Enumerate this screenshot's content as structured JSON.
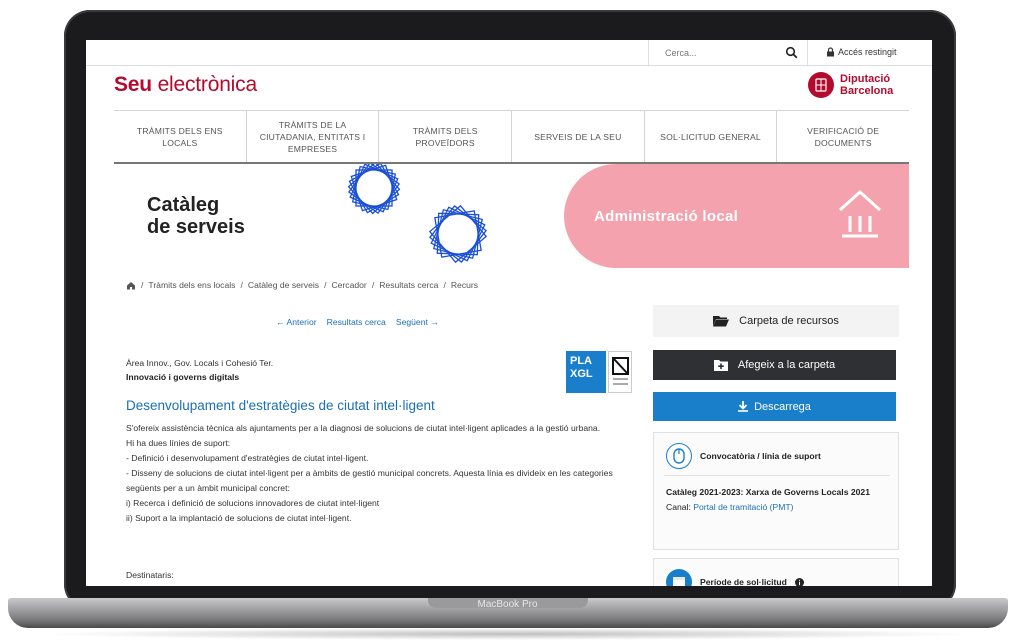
{
  "topbar": {
    "search_placeholder": "Cerca...",
    "restricted_access": "Accés restingit"
  },
  "header": {
    "brand_bold": "Seu",
    "brand_rest": "electrònica",
    "org_line1": "Diputació",
    "org_line2": "Barcelona"
  },
  "nav": {
    "items": [
      "TRÀMITS DELS ENS LOCALS",
      "TRÀMITS DE LA CIUTADANIA, ENTITATS I EMPRESES",
      "TRÀMITS DELS PROVEÏDORS",
      "SERVEIS DE LA SEU",
      "SOL·LICITUD GENERAL",
      "VERIFICACIÓ DE DOCUMENTS"
    ]
  },
  "banner": {
    "title_line1": "Catàleg",
    "title_line2": "de serveis",
    "section": "Administració local"
  },
  "breadcrumb": {
    "items": [
      "Tràmits dels ens locals",
      "Catàleg de serveis",
      "Cercador",
      "Resultats cerca",
      "Recurs"
    ]
  },
  "pager": {
    "prev": "← Anterior",
    "results": "Resultats cerca",
    "next": "Següent →"
  },
  "content": {
    "area": "Àrea Innov., Gov. Locals i Cohesió Ter.",
    "subarea": "Innovació i governs digitals",
    "badge_line1": "PLA",
    "badge_line2": "XGL",
    "title": "Desenvolupament d'estratègies de ciutat intel·ligent",
    "description": [
      "S'ofereix assistència tècnica als ajuntaments per a la diagnosi de solucions de ciutat intel·ligent aplicades a la gestió urbana.",
      "Hi ha dues línies de suport:",
      "- Definició i desenvolupament d'estratègies de ciutat intel·ligent.",
      "- Disseny de solucions de ciutat intel·ligent per a àmbits de gestió municipal concrets. Aquesta línia es divideix en les categories següents per a un àmbit municipal concret:",
      "i) Recerca i definició de solucions innovadores de ciutat intel·ligent",
      "ii) Suport a la implantació de solucions de ciutat intel·ligent."
    ],
    "recipients_label": "Destinataris:"
  },
  "sidebar": {
    "folder_label": "Carpeta de recursos",
    "add_label": "Afegeix a la carpeta",
    "download_label": "Descarrega",
    "card1_title": "Convocatòria / línia de suport",
    "card1_catalog": "Catàleg 2021-2023: Xarxa de Governs Locals 2021",
    "card1_channel_label": "Canal:",
    "card1_channel_link": "Portal de tramitació (PMT)",
    "card2_title": "Període de sol·licitud"
  },
  "device": {
    "brand": "MacBook Pro"
  },
  "colors": {
    "brand_red": "#b30b2f",
    "link_blue": "#1a6fb5",
    "button_blue": "#1a7fcb",
    "button_dark": "#2f3033",
    "banner_pink": "#f4a3ae"
  }
}
